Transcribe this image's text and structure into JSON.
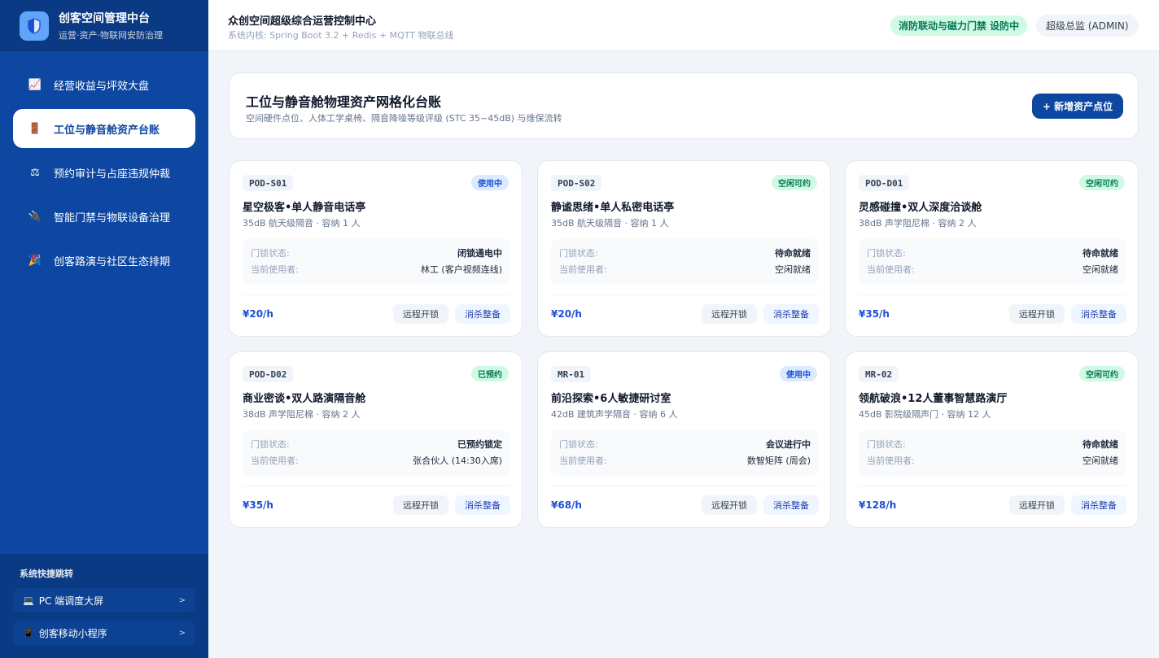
{
  "brand": {
    "title": "创客空间管理中台",
    "subtitle": "运营·资产·物联网安防治理",
    "logo_icon": "shield-icon"
  },
  "sidebar": {
    "items": [
      {
        "label": "经营收益与坪效大盘",
        "icon": "📈",
        "active": false
      },
      {
        "label": "工位与静音舱资产台账",
        "icon": "🚪",
        "active": true
      },
      {
        "label": "预约审计与占座违规仲裁",
        "icon": "⚖",
        "active": false
      },
      {
        "label": "智能门禁与物联设备治理",
        "icon": "🔌",
        "active": false
      },
      {
        "label": "创客路演与社区生态排期",
        "icon": "🎉",
        "active": false
      }
    ],
    "quick_title": "系统快捷跳转",
    "quick_links": [
      {
        "icon": "💻",
        "label": "PC 端调度大屏",
        "arrow": ">"
      },
      {
        "icon": "📱",
        "label": "创客移动小程序",
        "arrow": ">"
      }
    ]
  },
  "topbar": {
    "title": "众创空间超级综合运营控制中心",
    "subtitle": "系统内核: Spring Boot 3.2 + Redis + MQTT 物联总线",
    "alert": "消防联动与磁力门禁 设防中",
    "user": "超级总监 (ADMIN)"
  },
  "header": {
    "title": "工位与静音舱物理资产网格化台账",
    "subtitle": "空间硬件点位、人体工学桌椅、隔音降噪等级评级 (STC 35~45dB) 与维保流转",
    "add_button": "+ 新增资产点位"
  },
  "labels": {
    "lock": "门锁状态:",
    "user": "当前使用者:",
    "unlock_btn": "远程开锁",
    "clean_btn": "消杀整备"
  },
  "cards": [
    {
      "code": "POD-S01",
      "status": "使用中",
      "status_type": "busy",
      "name": "星空极客•单人静音电话亭",
      "desc": "35dB 航天级隔音 · 容纳 1 人",
      "lock": "闭锁通电中",
      "user": "林工 (客户视频连线)",
      "price": "¥20/h"
    },
    {
      "code": "POD-S02",
      "status": "空闲可约",
      "status_type": "free",
      "name": "静谧思绪•单人私密电话亭",
      "desc": "35dB 航天级隔音 · 容纳 1 人",
      "lock": "待命就绪",
      "user": "空闲就绪",
      "price": "¥20/h"
    },
    {
      "code": "POD-D01",
      "status": "空闲可约",
      "status_type": "free",
      "name": "灵感碰撞•双人深度洽谈舱",
      "desc": "38dB 声学阻尼棉 · 容纳 2 人",
      "lock": "待命就绪",
      "user": "空闲就绪",
      "price": "¥35/h"
    },
    {
      "code": "POD-D02",
      "status": "已预约",
      "status_type": "free",
      "name": "商业密谈•双人路演隔音舱",
      "desc": "38dB 声学阻尼棉 · 容纳 2 人",
      "lock": "已预约锁定",
      "user": "张合伙人 (14:30入席)",
      "price": "¥35/h"
    },
    {
      "code": "MR-01",
      "status": "使用中",
      "status_type": "busy",
      "name": "前沿探索•6人敏捷研讨室",
      "desc": "42dB 建筑声学隔音 · 容纳 6 人",
      "lock": "会议进行中",
      "user": "数智矩阵 (周会)",
      "price": "¥68/h"
    },
    {
      "code": "MR-02",
      "status": "空闲可约",
      "status_type": "free",
      "name": "领航破浪•12人董事智慧路演厅",
      "desc": "45dB 影院级隔声门 · 容纳 12 人",
      "lock": "待命就绪",
      "user": "空闲就绪",
      "price": "¥128/h"
    }
  ]
}
